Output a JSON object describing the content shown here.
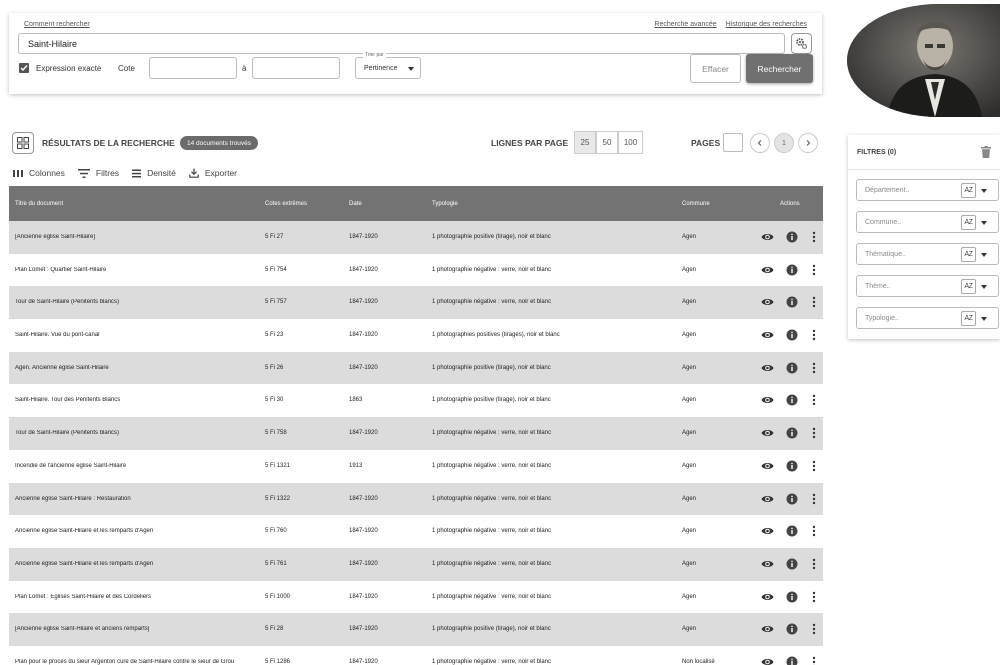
{
  "search": {
    "how_to_search": "Comment rechercher",
    "advanced_link": "Recherche avancée",
    "history_link": "Historique des recherches",
    "query_value": "Saint-Hilaire",
    "exact_label": "Expression exacte",
    "cote_label": "Cote",
    "a_label": "à",
    "sort_legend": "Trier par",
    "sort_value": "Pertinence",
    "clear_label": "Effacer",
    "search_label": "Rechercher"
  },
  "results": {
    "title": "RÉSULTATS DE LA RECHERCHE",
    "count_badge": "14 documents trouvés",
    "lines_per_page_label": "LIGNES PAR PAGE",
    "lines_options": [
      "25",
      "50",
      "100"
    ],
    "pages_label": "PAGES",
    "current_page": "1"
  },
  "toolbar": {
    "columns": "Colonnes",
    "filters": "Filtres",
    "density": "Densité",
    "export": "Exporter"
  },
  "table": {
    "headers": {
      "title": "Titre du document",
      "cotes": "Cotes extrêmes",
      "date": "Date",
      "typologie": "Typologie",
      "commune": "Commune",
      "actions": "Actions"
    },
    "rows": [
      {
        "title": "[Ancienne église Saint-Hilaire]",
        "cote": "5 Fi 27",
        "date": "1847-1920",
        "typo": "1 photographie positive (tirage), noir et blanc",
        "commune": "Agen"
      },
      {
        "title": "Plan Lomet : Quartier Saint-Hilaire",
        "cote": "5 Fi 754",
        "date": "1847-1920",
        "typo": "1 photographie négative : verre, noir et blanc",
        "commune": "Agen"
      },
      {
        "title": "Tour de Saint-Hilaire (Pénitents blancs)",
        "cote": "5 Fi 757",
        "date": "1847-1920",
        "typo": "1 photographie négative : verre, noir et blanc",
        "commune": "Agen"
      },
      {
        "title": "Saint-Hilaire. Vue du pont-canal",
        "cote": "5 Fi 23",
        "date": "1847-1920",
        "typo": "1 photographies positives (tirages), noir et blanc",
        "commune": "Agen"
      },
      {
        "title": "Agen. Ancienne église Saint-Hilaire",
        "cote": "5 Fi 26",
        "date": "1847-1920",
        "typo": "1 photographie positive (tirage), noir et blanc",
        "commune": "Agen"
      },
      {
        "title": "Saint-Hilaire. Tour des Pénitents Blancs",
        "cote": "5 Fi 30",
        "date": "1863",
        "typo": "1 photographie positive (tirage), noir et blanc",
        "commune": "Agen"
      },
      {
        "title": "Tour de Saint-Hilaire (Pénitents blancs)",
        "cote": "5 Fi 758",
        "date": "1847-1920",
        "typo": "1 photographie négative : verre, noir et blanc",
        "commune": "Agen"
      },
      {
        "title": "Incendie de l'ancienne église Saint-Hilaire",
        "cote": "5 Fi 1321",
        "date": "1913",
        "typo": "1 photographie négative : verre, noir et blanc",
        "commune": "Agen"
      },
      {
        "title": "Ancienne église Saint-Hilaire : Restauration",
        "cote": "5 Fi 1322",
        "date": "1847-1920",
        "typo": "1 photographie négative : verre, noir et blanc",
        "commune": "Agen"
      },
      {
        "title": "Ancienne église Saint-Hilaire et les remparts d'Agen",
        "cote": "5 Fi 760",
        "date": "1847-1920",
        "typo": "1 photographie négative : verre, noir et blanc",
        "commune": "Agen"
      },
      {
        "title": "Ancienne église Saint-Hilaire et les remparts d'Agen",
        "cote": "5 Fi 761",
        "date": "1847-1920",
        "typo": "1 photographie négative : verre, noir et blanc",
        "commune": "Agen"
      },
      {
        "title": "Plan Lomet : Églises Saint-Hilaire et des Cordeliers",
        "cote": "5 Fi 1000",
        "date": "1847-1920",
        "typo": "1 photographie négative : verre, noir et blanc",
        "commune": "Agen"
      },
      {
        "title": "[Ancienne église Saint-Hilaire et anciens remparts]",
        "cote": "5 Fi 28",
        "date": "1847-1920",
        "typo": "1 photographie positive (tirage), noir et blanc",
        "commune": "Agen"
      },
      {
        "title": "Plan pour le procès du sieur Argenton curé de Saint-Hilaire contre le sieur de Grou",
        "cote": "5 Fi 1286",
        "date": "1847-1920",
        "typo": "1 photographie négative : verre, noir et blanc",
        "commune": "Non localisé"
      }
    ]
  },
  "filters": {
    "title": "FILTRES (0)",
    "fields": [
      "Département..",
      "Commune..",
      "Thématique..",
      "Thème..",
      "Typologie.."
    ],
    "az_label": "AZ"
  },
  "icons": {
    "settings": "gears-icon",
    "results": "grid-view-icon",
    "columns": "columns-icon",
    "filter": "filter-lines-icon",
    "density": "density-icon",
    "export": "download-icon",
    "view": "eye-icon",
    "info": "info-icon",
    "more": "more-vertical-icon",
    "trash": "trash-icon"
  }
}
